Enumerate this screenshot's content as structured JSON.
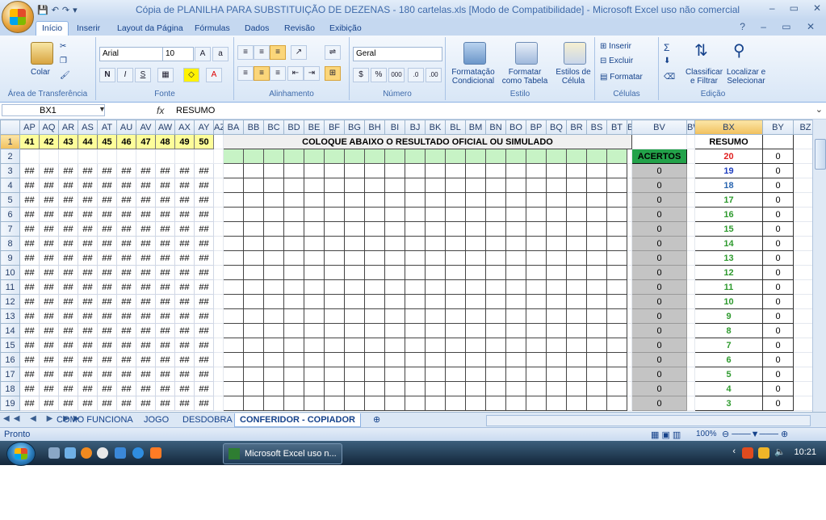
{
  "title_bar": {
    "title": "Cópia de PLANILHA PARA SUBSTITUIÇÃO DE DEZENAS - 180 cartelas.xls  [Modo de Compatibilidade] - Microsoft Excel uso não comercial",
    "minimize": "–",
    "restore": "▭",
    "close": "✕"
  },
  "quick_access": {
    "save": "💾",
    "undo": "↶",
    "redo": "↷",
    "customize": "▾"
  },
  "ribbon_tabs": [
    "Início",
    "Inserir",
    "Layout da Página",
    "Fórmulas",
    "Dados",
    "Revisão",
    "Exibição"
  ],
  "ribbon": {
    "clipboard": {
      "paste": "Colar",
      "label": "Área de Transferência"
    },
    "font": {
      "name": "Arial",
      "size": "10",
      "bold": "N",
      "italic": "I",
      "underline": "S",
      "label": "Fonte"
    },
    "alignment": {
      "label": "Alinhamento"
    },
    "number": {
      "format": "Geral",
      "percent": "%",
      "thousands": "000",
      "label": "Número"
    },
    "styles": {
      "conditional": "Formatação Condicional",
      "as_table": "Formatar como Tabela",
      "cell_styles": "Estilos de Célula",
      "label": "Estilo"
    },
    "cells": {
      "insert": "Inserir",
      "delete": "Excluir",
      "format": "Formatar",
      "label": "Células"
    },
    "editing": {
      "sum": "Σ",
      "sort_filter": "Classificar e Filtrar",
      "find_select": "Localizar e Selecionar",
      "label": "Edição"
    }
  },
  "formula_bar": {
    "name_box": "BX1",
    "fx": "fx",
    "value": "RESUMO"
  },
  "column_headers": [
    "AP",
    "AQ",
    "AR",
    "AS",
    "AT",
    "AU",
    "AV",
    "AW",
    "AX",
    "AY",
    "AZ",
    "BA",
    "BB",
    "BC",
    "BD",
    "BE",
    "BF",
    "BG",
    "BH",
    "BI",
    "BJ",
    "BK",
    "BL",
    "BM",
    "BN",
    "BO",
    "BP",
    "BQ",
    "BR",
    "BS",
    "BT",
    "BU",
    "BV",
    "BW",
    "BX",
    "BY",
    "BZ"
  ],
  "row_numbers": [
    "1",
    "2",
    "3",
    "4",
    "5",
    "6",
    "7",
    "8",
    "9",
    "10",
    "11",
    "12",
    "13",
    "14",
    "15",
    "16",
    "17",
    "18",
    "19"
  ],
  "row1_numbers": [
    "41",
    "42",
    "43",
    "44",
    "45",
    "46",
    "47",
    "48",
    "49",
    "50"
  ],
  "hash_value": "##",
  "banner": "COLOQUE ABAIXO O RESULTADO OFICIAL OU SIMULADO",
  "acertos_label": "ACERTOS",
  "bv_value": "0",
  "resumo": {
    "label": "RESUMO",
    "hits": [
      "20",
      "19",
      "18",
      "17",
      "16",
      "15",
      "14",
      "13",
      "12",
      "11",
      "10",
      "9",
      "8",
      "7",
      "6",
      "5",
      "4",
      "3"
    ],
    "counts": [
      "0",
      "0",
      "0",
      "0",
      "0",
      "0",
      "0",
      "0",
      "0",
      "0",
      "0",
      "0",
      "0",
      "0",
      "0",
      "0",
      "0",
      "0"
    ],
    "colors": {
      "20": "#e02020",
      "19": "#1f3fc0",
      "18": "#2a66b0",
      "other": "#2e9a2e"
    }
  },
  "sheet_tabs": [
    "COMO FUNCIONA",
    "JOGO",
    "DESDOBRA",
    "CONFERIDOR - COPIADOR"
  ],
  "active_sheet": "CONFERIDOR - COPIADOR",
  "status": {
    "ready": "Pronto",
    "zoom": "100%"
  },
  "taskbar": {
    "excel_task": "Microsoft Excel uso n...",
    "clock": "10:21"
  }
}
